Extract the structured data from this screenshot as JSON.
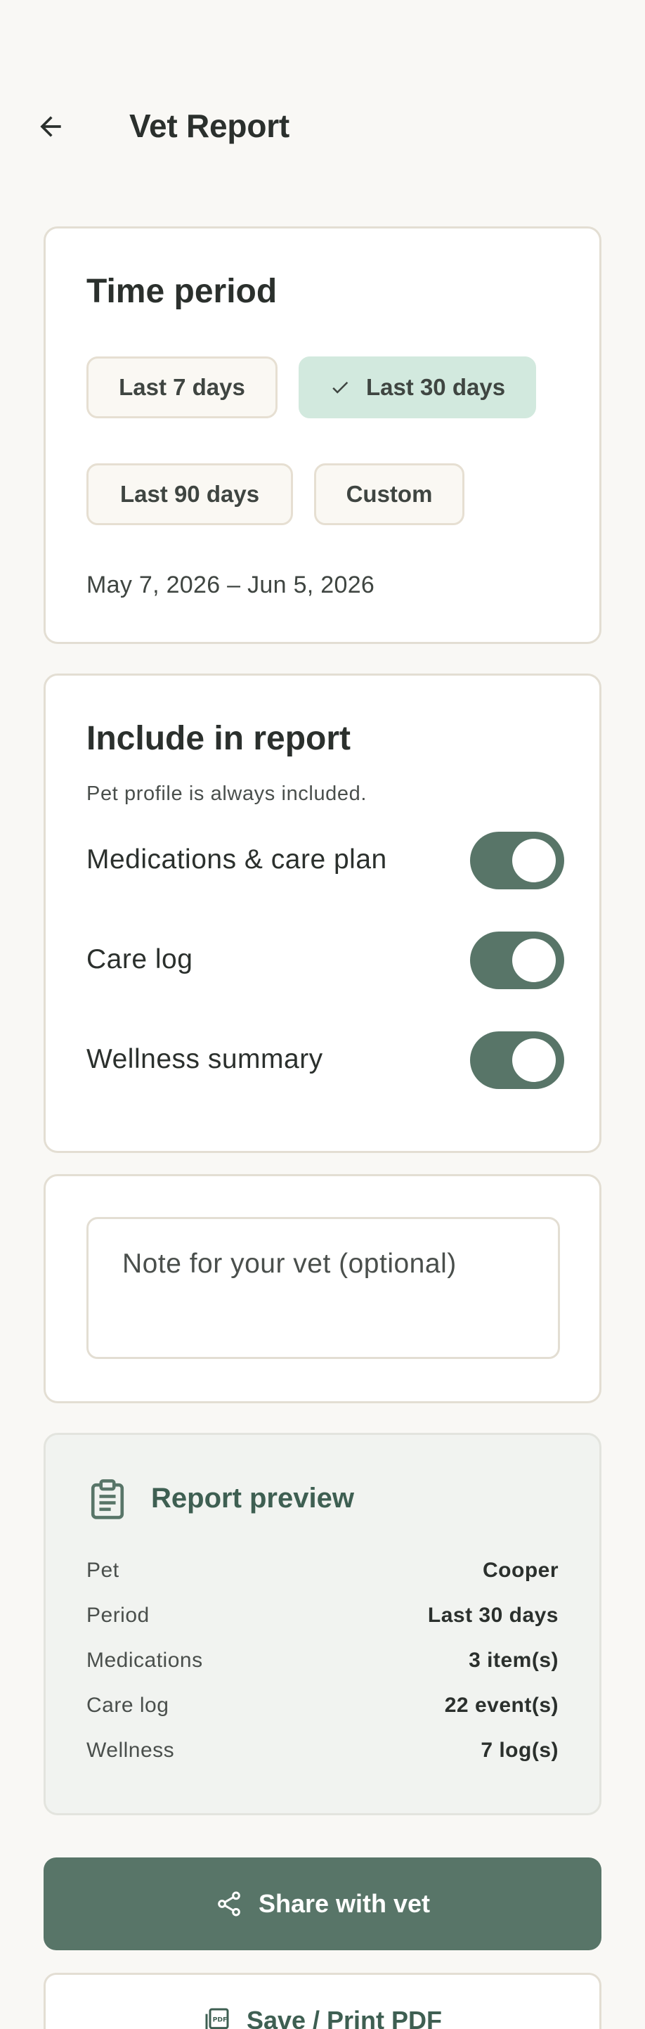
{
  "header": {
    "title": "Vet Report",
    "back_icon": "arrow-left-icon"
  },
  "time_period": {
    "title": "Time period",
    "chips": [
      {
        "label": "Last 7 days",
        "selected": false
      },
      {
        "label": "Last 30 days",
        "selected": true
      },
      {
        "label": "Last 90 days",
        "selected": false
      },
      {
        "label": "Custom",
        "selected": false
      }
    ],
    "date_range": "May 7, 2026 – Jun 5, 2026"
  },
  "include": {
    "title": "Include in report",
    "subtitle": "Pet profile is always included.",
    "toggles": [
      {
        "label": "Medications & care plan",
        "on": true
      },
      {
        "label": "Care log",
        "on": true
      },
      {
        "label": "Wellness summary",
        "on": true
      }
    ]
  },
  "note": {
    "placeholder": "Note for your vet (optional)",
    "value": ""
  },
  "preview": {
    "title": "Report preview",
    "icon": "clipboard-icon",
    "rows": [
      {
        "key": "Pet",
        "value": "Cooper"
      },
      {
        "key": "Period",
        "value": "Last 30 days"
      },
      {
        "key": "Medications",
        "value": "3 item(s)"
      },
      {
        "key": "Care log",
        "value": "22 event(s)"
      },
      {
        "key": "Wellness",
        "value": "7 log(s)"
      }
    ]
  },
  "actions": {
    "share_label": "Share with vet",
    "share_icon": "share-icon",
    "pdf_label": "Save / Print PDF",
    "pdf_icon": "pdf-file-icon"
  },
  "colors": {
    "background": "#f9f8f5",
    "primary": "#587568",
    "selected_chip": "#d2e9de",
    "preview_title": "#3e5f52"
  }
}
